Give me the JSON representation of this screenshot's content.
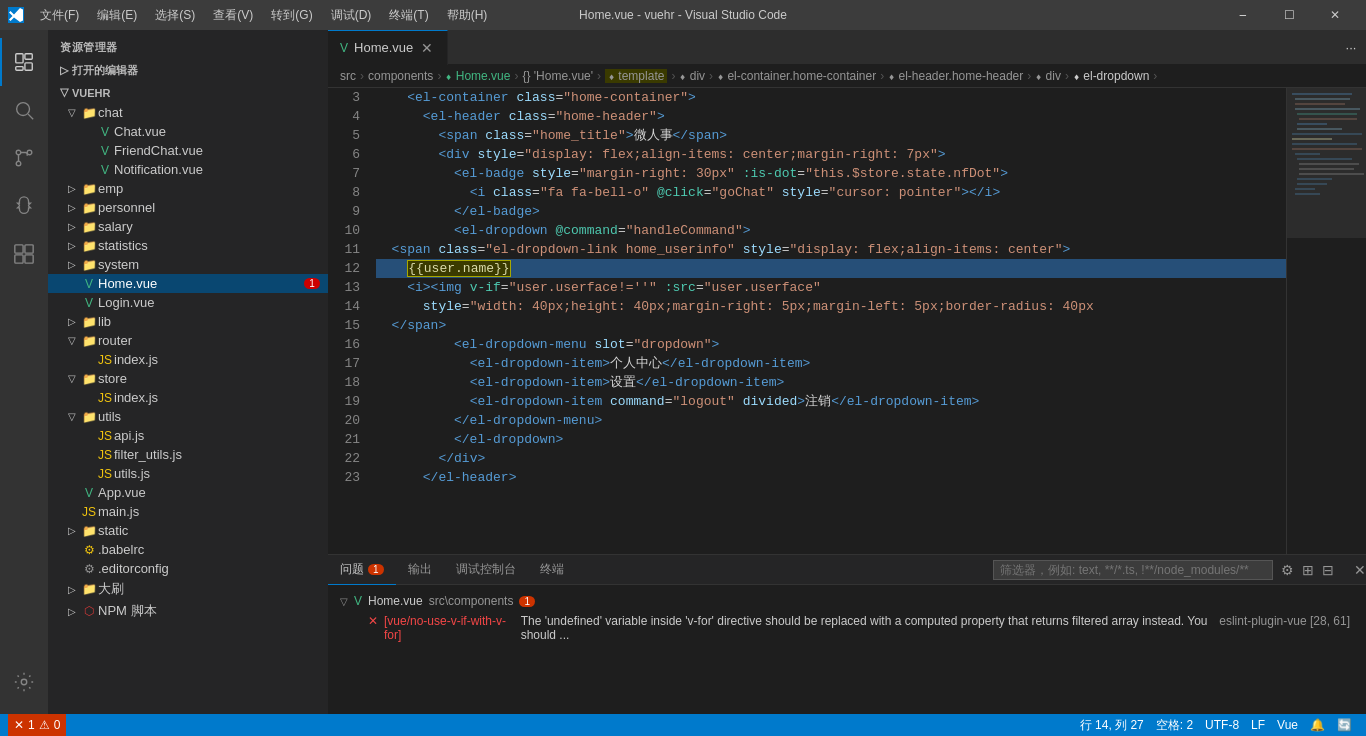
{
  "titleBar": {
    "title": "Home.vue - vuehr - Visual Studio Code",
    "menus": [
      "文件(F)",
      "编辑(E)",
      "选择(S)",
      "查看(V)",
      "转到(G)",
      "调试(D)",
      "终端(T)",
      "帮助(H)"
    ],
    "controls": [
      "—",
      "⬜",
      "✕"
    ]
  },
  "activityBar": {
    "items": [
      "explorer",
      "search",
      "git",
      "debug",
      "extensions"
    ]
  },
  "sidebar": {
    "header": "资源管理器",
    "openEditors": "打开的编辑器",
    "projectName": "VUEHR",
    "tree": {
      "chat": {
        "label": "chat",
        "expanded": true,
        "children": [
          {
            "label": "Chat.vue",
            "type": "vue"
          },
          {
            "label": "FriendChat.vue",
            "type": "vue"
          },
          {
            "label": "Notification.vue",
            "type": "vue"
          }
        ]
      },
      "emp": {
        "label": "emp",
        "type": "folder"
      },
      "personnel": {
        "label": "personnel",
        "type": "folder"
      },
      "salary": {
        "label": "salary",
        "type": "folder"
      },
      "statistics": {
        "label": "statistics",
        "type": "folder"
      },
      "system": {
        "label": "system",
        "type": "folder"
      },
      "homeVue": {
        "label": "Home.vue",
        "type": "vue",
        "badge": "1"
      },
      "loginVue": {
        "label": "Login.vue",
        "type": "vue"
      },
      "lib": {
        "label": "lib",
        "type": "folder"
      },
      "router": {
        "label": "router",
        "expanded": true,
        "children": [
          {
            "label": "index.js",
            "type": "js"
          }
        ]
      },
      "store": {
        "label": "store",
        "expanded": true,
        "children": [
          {
            "label": "index.js",
            "type": "js"
          }
        ]
      },
      "utils": {
        "label": "utils",
        "expanded": true,
        "children": [
          {
            "label": "api.js",
            "type": "js"
          },
          {
            "label": "filter_utils.js",
            "type": "js"
          },
          {
            "label": "utils.js",
            "type": "js"
          }
        ]
      },
      "appVue": {
        "label": "App.vue",
        "type": "vue"
      },
      "mainJs": {
        "label": "main.js",
        "type": "js"
      },
      "static": {
        "label": "static",
        "type": "folder"
      },
      "babelrc": {
        "label": ".babelrc",
        "type": "config"
      },
      "editorconfig": {
        "label": ".editorconfig",
        "type": "config"
      },
      "daquao": {
        "label": "大刷",
        "type": "folder"
      },
      "npmScript": {
        "label": "NPM 脚本",
        "type": "npm"
      }
    }
  },
  "tabs": [
    {
      "label": "Home.vue",
      "active": true,
      "type": "vue"
    }
  ],
  "breadcrumb": {
    "items": [
      "src",
      "components",
      "Home.vue",
      "{} 'Home.vue'",
      "template",
      "div",
      "el-container.home-container",
      "el-header.home-header",
      "div",
      "el-dropdown"
    ]
  },
  "editor": {
    "lines": [
      {
        "num": 3,
        "content": "    <el-container class=\"home-container\">"
      },
      {
        "num": 4,
        "content": "      <el-header class=\"home-header\">"
      },
      {
        "num": 5,
        "content": "        <span class=\"home_title\">微人事</span>"
      },
      {
        "num": 6,
        "content": "        <div style=\"display: flex;align-items: center;margin-right: 7px\">"
      },
      {
        "num": 7,
        "content": "          <el-badge style=\"margin-right: 30px\" :is-dot=\"this.$store.state.nfDot\">"
      },
      {
        "num": 8,
        "content": "            <i class=\"fa fa-bell-o\" @click=\"goChat\" style=\"cursor: pointer\"></i>"
      },
      {
        "num": 9,
        "content": "          </el-badge>"
      },
      {
        "num": 10,
        "content": "          <el-dropdown @command=\"handleCommand\">"
      },
      {
        "num": 11,
        "content": "  <span class=\"el-dropdown-link home_userinfo\" style=\"display: flex;align-items: center\">"
      },
      {
        "num": 12,
        "content": "    {{user.name}}",
        "highlighted": true
      },
      {
        "num": 13,
        "content": "    <i><img v-if=\"user.userface!=''\" :src=\"user.userface\""
      },
      {
        "num": 14,
        "content": "      style=\"width: 40px;height: 40px;margin-right: 5px;margin-left: 5px;border-radius: 40px"
      },
      {
        "num": 15,
        "content": "  </span>"
      },
      {
        "num": 16,
        "content": "          <el-dropdown-menu slot=\"dropdown\">"
      },
      {
        "num": 17,
        "content": "            <el-dropdown-item>个人中心</el-dropdown-item>"
      },
      {
        "num": 18,
        "content": "            <el-dropdown-item>设置</el-dropdown-item>"
      },
      {
        "num": 19,
        "content": "            <el-dropdown-item command=\"logout\" divided>注销</el-dropdown-item>"
      },
      {
        "num": 20,
        "content": "          </el-dropdown-menu>"
      },
      {
        "num": 21,
        "content": "          </el-dropdown>"
      },
      {
        "num": 22,
        "content": "        </div>"
      },
      {
        "num": 23,
        "content": "      </el-header>"
      }
    ]
  },
  "panel": {
    "tabs": [
      {
        "label": "问题",
        "badge": "1",
        "active": true
      },
      {
        "label": "输出",
        "active": false
      },
      {
        "label": "调试控制台",
        "active": false
      },
      {
        "label": "终端",
        "active": false
      }
    ],
    "filterPlaceholder": "筛选器，例如: text, **/*.ts, !**/node_modules/**",
    "errorSection": {
      "filename": "Home.vue",
      "path": "src\\components",
      "count": "1",
      "errors": [
        {
          "icon": "✕",
          "message": "[vue/no-use-v-if-with-v-for]",
          "detail": "The 'undefined' variable inside 'v-for' directive should be replaced with a computed property that returns filtered array instead. You should ...",
          "source": "eslint-plugin-vue [28, 61]"
        }
      ]
    }
  },
  "statusBar": {
    "errors": "1",
    "warnings": "0",
    "branch": "行 14, 列 27",
    "spaces": "空格: 2",
    "encoding": "UTF-8",
    "lineEnding": "LF",
    "language": "Vue",
    "bell": "🔔",
    "sync": "🔄"
  }
}
